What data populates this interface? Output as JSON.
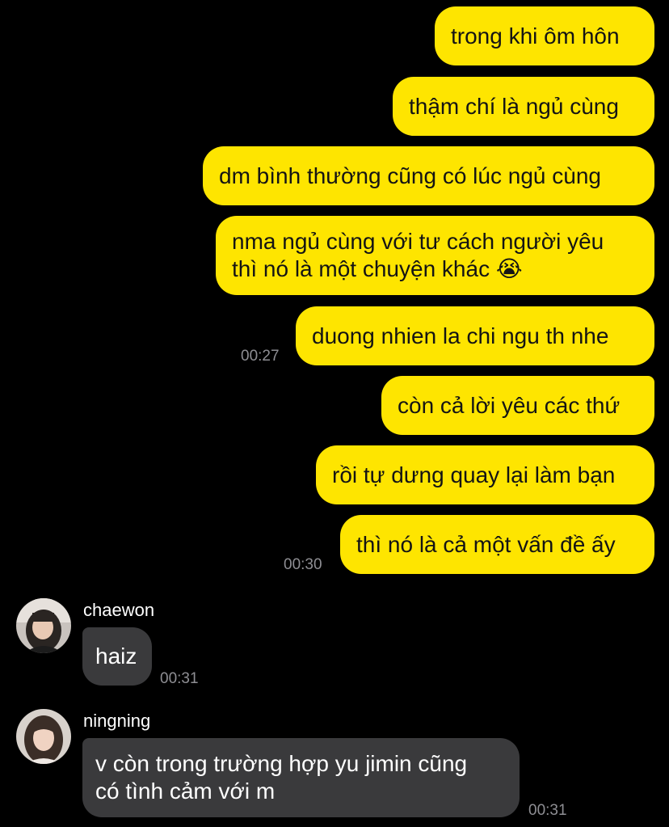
{
  "messages_out": [
    {
      "text": "trong khi ôm hôn"
    },
    {
      "text": "thậm chí là ngủ cùng"
    },
    {
      "text": "dm bình thường cũng có lúc ngủ cùng"
    },
    {
      "text_line1": "nma ngủ cùng với tư cách người yêu",
      "text_line2": "thì nó là một chuyện khác",
      "emoji": "😭"
    },
    {
      "text": "duong nhien la chi ngu th nhe",
      "time": "00:27"
    },
    {
      "text": "còn cả lời yêu các thứ"
    },
    {
      "text": "rồi tự dưng quay lại làm bạn"
    },
    {
      "text": "thì nó là cả một vấn đề ấy",
      "time": "00:30"
    }
  ],
  "messages_in": [
    {
      "sender": "chaewon",
      "text": "haiz",
      "time": "00:31"
    },
    {
      "sender": "ningning",
      "text_line1": "v còn trong trường hợp yu jimin cũng",
      "text_line2": "có tình cảm với m",
      "time": "00:31"
    }
  ],
  "colors": {
    "background": "#000000",
    "outgoing_bubble": "#FEE500",
    "incoming_bubble": "#3A3A3C",
    "timestamp": "#8E8E93"
  }
}
